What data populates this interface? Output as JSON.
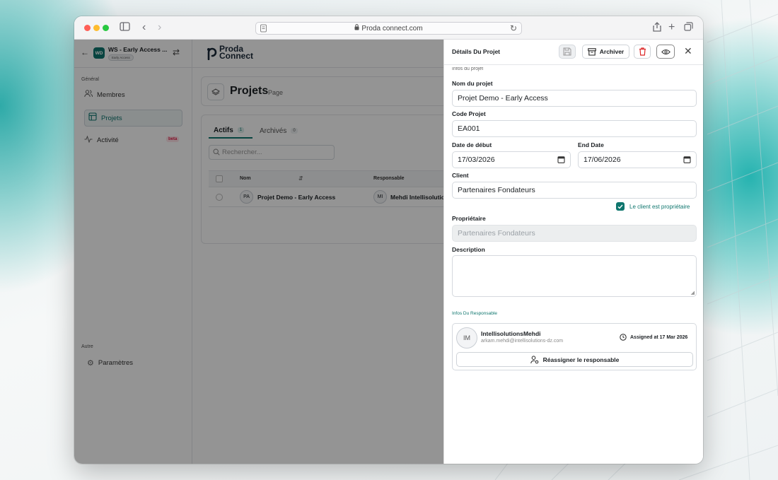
{
  "browser": {
    "url": "Proda connect.com"
  },
  "sidebar": {
    "workspace_initials": "WD",
    "workspace_name": "WS - Early Access ...",
    "workspace_badge": "Early Access",
    "section_general": "Général",
    "items": [
      {
        "label": "Membres"
      },
      {
        "label": "Projets"
      },
      {
        "label": "Activité",
        "badge": "beta"
      }
    ],
    "section_other": "Autre",
    "settings_label": "Paramètres"
  },
  "main": {
    "logo_line1": "Proda",
    "logo_line2": "Connect",
    "page_title": "Projets",
    "page_subtitle": "Page",
    "tabs": [
      {
        "label": "Actifs",
        "count": "1"
      },
      {
        "label": "Archivés",
        "count": "0"
      }
    ],
    "search_placeholder": "Rechercher...",
    "table": {
      "columns": [
        "Nom",
        "Responsable"
      ],
      "rows": [
        {
          "initials": "PA",
          "name": "Projet Demo - Early Access",
          "resp_initials": "MI",
          "responsable": "Mehdi Intellisolutio"
        }
      ]
    }
  },
  "panel": {
    "title": "Détails Du Projet",
    "archive_label": "Archiver",
    "section_partial": "Infos du projet",
    "name_label": "Nom du projet",
    "name_value": "Projet Demo - Early Access",
    "code_label": "Code Projet",
    "code_value": "EA001",
    "start_label": "Date de début",
    "start_value": "17/03/2026",
    "end_label": "End Date",
    "end_value": "17/06/2026",
    "client_label": "Client",
    "client_value": "Partenaires Fondateurs",
    "owner_checkbox_label": "Le client est propriétaire",
    "owner_checked": true,
    "owner_label": "Propriétaire",
    "owner_value": "Partenaires Fondateurs",
    "description_label": "Description",
    "description_value": "",
    "responsible_section": "Infos Du Responsable",
    "responsible_initials": "IM",
    "responsible_name": "IntellisolutionsMehdi",
    "responsible_email": "arkam.mehdi@intellisolutions-dz.com",
    "assigned_text": "Assigned at 17 Mar 2026",
    "reassign_label": "Réassigner le responsable"
  },
  "colors": {
    "accent": "#0f766e",
    "danger": "#dc2626",
    "badge": "#e11d48"
  }
}
